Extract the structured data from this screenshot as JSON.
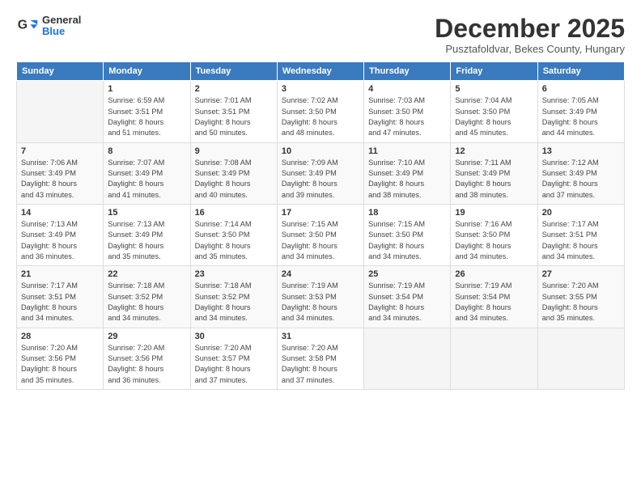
{
  "logo": {
    "general": "General",
    "blue": "Blue"
  },
  "header": {
    "month": "December 2025",
    "location": "Pusztafoldvar, Bekes County, Hungary"
  },
  "weekdays": [
    "Sunday",
    "Monday",
    "Tuesday",
    "Wednesday",
    "Thursday",
    "Friday",
    "Saturday"
  ],
  "weeks": [
    [
      {
        "day": "",
        "info": ""
      },
      {
        "day": "1",
        "info": "Sunrise: 6:59 AM\nSunset: 3:51 PM\nDaylight: 8 hours\nand 51 minutes."
      },
      {
        "day": "2",
        "info": "Sunrise: 7:01 AM\nSunset: 3:51 PM\nDaylight: 8 hours\nand 50 minutes."
      },
      {
        "day": "3",
        "info": "Sunrise: 7:02 AM\nSunset: 3:50 PM\nDaylight: 8 hours\nand 48 minutes."
      },
      {
        "day": "4",
        "info": "Sunrise: 7:03 AM\nSunset: 3:50 PM\nDaylight: 8 hours\nand 47 minutes."
      },
      {
        "day": "5",
        "info": "Sunrise: 7:04 AM\nSunset: 3:50 PM\nDaylight: 8 hours\nand 45 minutes."
      },
      {
        "day": "6",
        "info": "Sunrise: 7:05 AM\nSunset: 3:49 PM\nDaylight: 8 hours\nand 44 minutes."
      }
    ],
    [
      {
        "day": "7",
        "info": "Sunrise: 7:06 AM\nSunset: 3:49 PM\nDaylight: 8 hours\nand 43 minutes."
      },
      {
        "day": "8",
        "info": "Sunrise: 7:07 AM\nSunset: 3:49 PM\nDaylight: 8 hours\nand 41 minutes."
      },
      {
        "day": "9",
        "info": "Sunrise: 7:08 AM\nSunset: 3:49 PM\nDaylight: 8 hours\nand 40 minutes."
      },
      {
        "day": "10",
        "info": "Sunrise: 7:09 AM\nSunset: 3:49 PM\nDaylight: 8 hours\nand 39 minutes."
      },
      {
        "day": "11",
        "info": "Sunrise: 7:10 AM\nSunset: 3:49 PM\nDaylight: 8 hours\nand 38 minutes."
      },
      {
        "day": "12",
        "info": "Sunrise: 7:11 AM\nSunset: 3:49 PM\nDaylight: 8 hours\nand 38 minutes."
      },
      {
        "day": "13",
        "info": "Sunrise: 7:12 AM\nSunset: 3:49 PM\nDaylight: 8 hours\nand 37 minutes."
      }
    ],
    [
      {
        "day": "14",
        "info": "Sunrise: 7:13 AM\nSunset: 3:49 PM\nDaylight: 8 hours\nand 36 minutes."
      },
      {
        "day": "15",
        "info": "Sunrise: 7:13 AM\nSunset: 3:49 PM\nDaylight: 8 hours\nand 35 minutes."
      },
      {
        "day": "16",
        "info": "Sunrise: 7:14 AM\nSunset: 3:50 PM\nDaylight: 8 hours\nand 35 minutes."
      },
      {
        "day": "17",
        "info": "Sunrise: 7:15 AM\nSunset: 3:50 PM\nDaylight: 8 hours\nand 34 minutes."
      },
      {
        "day": "18",
        "info": "Sunrise: 7:15 AM\nSunset: 3:50 PM\nDaylight: 8 hours\nand 34 minutes."
      },
      {
        "day": "19",
        "info": "Sunrise: 7:16 AM\nSunset: 3:50 PM\nDaylight: 8 hours\nand 34 minutes."
      },
      {
        "day": "20",
        "info": "Sunrise: 7:17 AM\nSunset: 3:51 PM\nDaylight: 8 hours\nand 34 minutes."
      }
    ],
    [
      {
        "day": "21",
        "info": "Sunrise: 7:17 AM\nSunset: 3:51 PM\nDaylight: 8 hours\nand 34 minutes."
      },
      {
        "day": "22",
        "info": "Sunrise: 7:18 AM\nSunset: 3:52 PM\nDaylight: 8 hours\nand 34 minutes."
      },
      {
        "day": "23",
        "info": "Sunrise: 7:18 AM\nSunset: 3:52 PM\nDaylight: 8 hours\nand 34 minutes."
      },
      {
        "day": "24",
        "info": "Sunrise: 7:19 AM\nSunset: 3:53 PM\nDaylight: 8 hours\nand 34 minutes."
      },
      {
        "day": "25",
        "info": "Sunrise: 7:19 AM\nSunset: 3:54 PM\nDaylight: 8 hours\nand 34 minutes."
      },
      {
        "day": "26",
        "info": "Sunrise: 7:19 AM\nSunset: 3:54 PM\nDaylight: 8 hours\nand 34 minutes."
      },
      {
        "day": "27",
        "info": "Sunrise: 7:20 AM\nSunset: 3:55 PM\nDaylight: 8 hours\nand 35 minutes."
      }
    ],
    [
      {
        "day": "28",
        "info": "Sunrise: 7:20 AM\nSunset: 3:56 PM\nDaylight: 8 hours\nand 35 minutes."
      },
      {
        "day": "29",
        "info": "Sunrise: 7:20 AM\nSunset: 3:56 PM\nDaylight: 8 hours\nand 36 minutes."
      },
      {
        "day": "30",
        "info": "Sunrise: 7:20 AM\nSunset: 3:57 PM\nDaylight: 8 hours\nand 37 minutes."
      },
      {
        "day": "31",
        "info": "Sunrise: 7:20 AM\nSunset: 3:58 PM\nDaylight: 8 hours\nand 37 minutes."
      },
      {
        "day": "",
        "info": ""
      },
      {
        "day": "",
        "info": ""
      },
      {
        "day": "",
        "info": ""
      }
    ]
  ]
}
